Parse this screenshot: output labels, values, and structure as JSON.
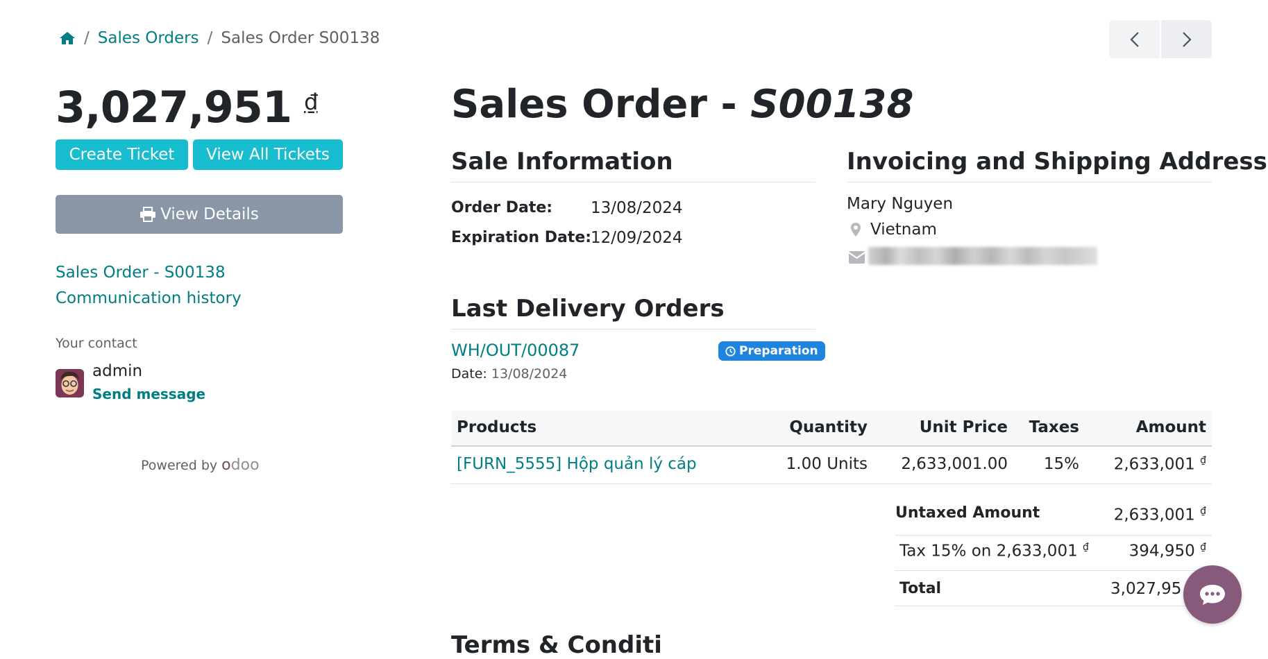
{
  "breadcrumb": {
    "sales_orders": "Sales Orders",
    "current": "Sales Order S00138",
    "sep": "/"
  },
  "sidebar": {
    "amount": "3,027,951",
    "currency": "₫",
    "create_ticket": "Create Ticket",
    "view_all_tickets": "View All Tickets",
    "view_details": "View Details",
    "links": [
      "Sales Order - S00138",
      "Communication history"
    ],
    "your_contact": "Your contact",
    "contact_name": "admin",
    "send_message": "Send message",
    "powered_by": "Powered by",
    "odoo": "odoo"
  },
  "main": {
    "title_prefix": "Sales Order - ",
    "title_ref": "S00138",
    "sale_info": {
      "heading": "Sale Information",
      "order_date_label": "Order Date:",
      "order_date": "13/08/2024",
      "expiration_label": "Expiration Date:",
      "expiration_date": "12/09/2024"
    },
    "address": {
      "heading": "Invoicing and Shipping Address",
      "name": "Mary Nguyen",
      "country": "Vietnam"
    },
    "delivery": {
      "heading": "Last Delivery Orders",
      "ref": "WH/OUT/00087",
      "status": "Preparation",
      "date_label": "Date:",
      "date": "13/08/2024"
    },
    "table": {
      "headers": {
        "products": "Products",
        "quantity": "Quantity",
        "unit_price": "Unit Price",
        "taxes": "Taxes",
        "amount": "Amount"
      },
      "rows": [
        {
          "product": "[FURN_5555] Hộp quản lý cáp",
          "quantity": "1.00 Units",
          "unit_price": "2,633,001.00",
          "taxes": "15%",
          "amount": "2,633,001",
          "currency": "₫"
        }
      ]
    },
    "totals": {
      "untaxed_label": "Untaxed Amount",
      "untaxed_value": "2,633,001",
      "tax_label": "Tax 15% on 2,633,001",
      "tax_value": "394,950",
      "total_label": "Total",
      "total_value": "3,027,95"
    },
    "next_heading_partial": "Terms & Conditi"
  },
  "colors": {
    "link": "#017e84",
    "teal_button": "#17bccf",
    "grey_button": "#8996a6",
    "badge": "#1f84de",
    "chat": "#875a7b"
  }
}
